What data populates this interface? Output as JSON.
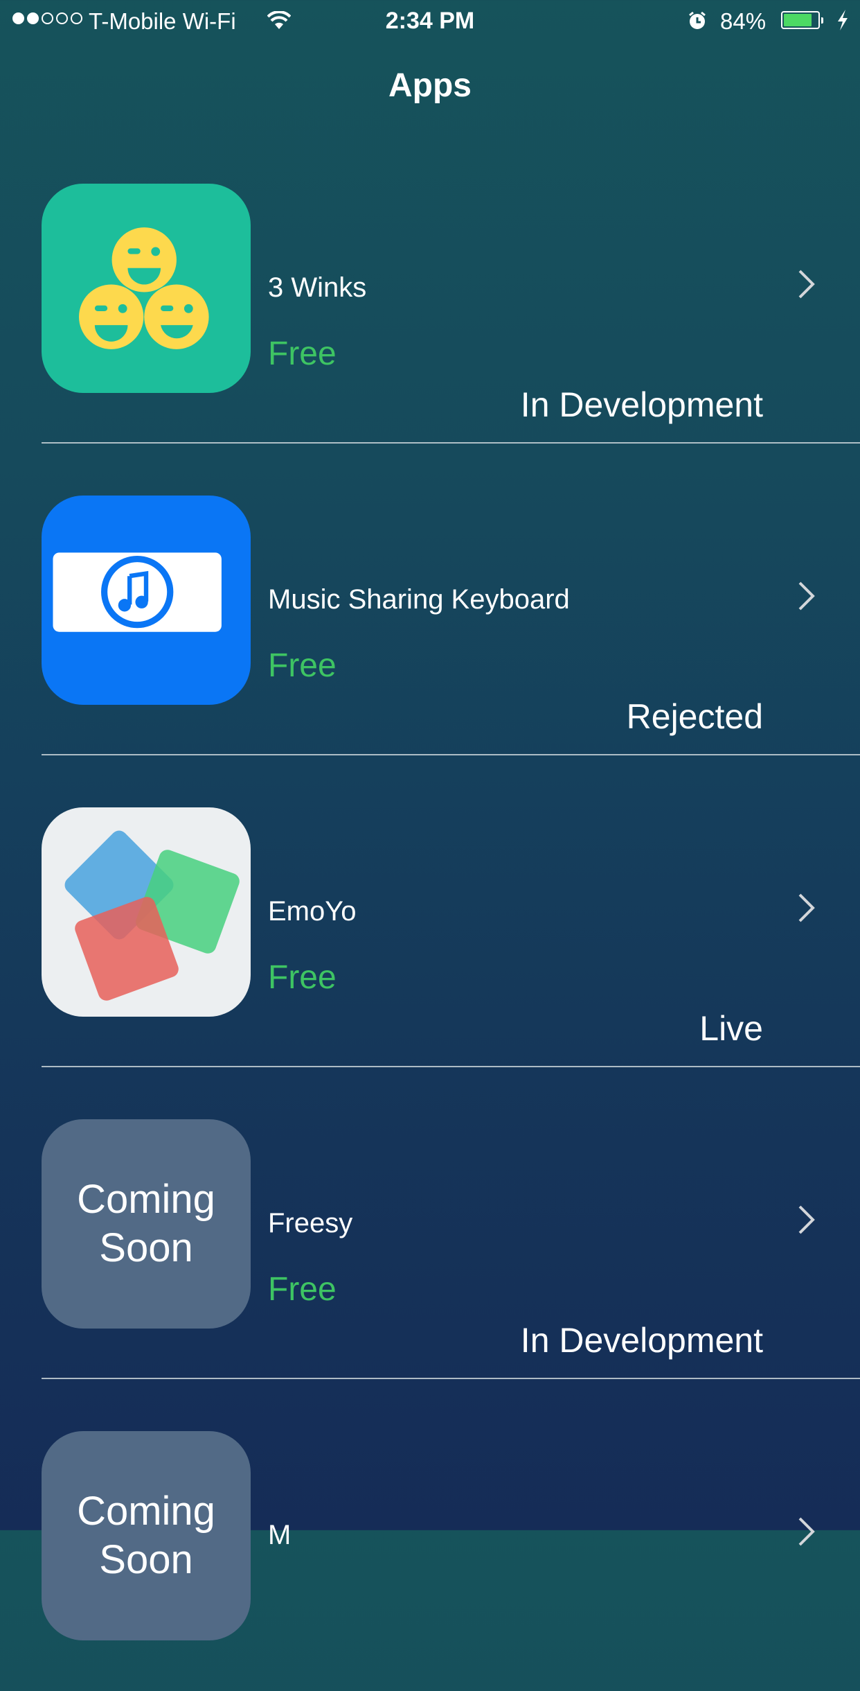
{
  "status_bar": {
    "signal_bars_filled": 2,
    "signal_bars_total": 5,
    "carrier": "T-Mobile Wi-Fi",
    "time": "2:34 PM",
    "battery_percent": "84%",
    "battery_level": 0.84,
    "charging": true
  },
  "nav": {
    "title": "Apps"
  },
  "colors": {
    "price": "#3ec463",
    "battery": "#4cd964"
  },
  "apps": [
    {
      "name": "3 Winks",
      "price": "Free",
      "status": "In Development",
      "icon": "three-winks-icon"
    },
    {
      "name": "Music Sharing Keyboard",
      "price": "Free",
      "status": "Rejected",
      "icon": "music-keyboard-icon"
    },
    {
      "name": "EmoYo",
      "price": "Free",
      "status": "Live",
      "icon": "emoyo-icon"
    },
    {
      "name": "Freesy",
      "price": "Free",
      "status": "In Development",
      "icon": "coming-soon-icon",
      "placeholder_text": "Coming Soon"
    },
    {
      "name": "M",
      "price": "",
      "status": "",
      "icon": "coming-soon-icon",
      "placeholder_text": "Coming Soon"
    }
  ]
}
